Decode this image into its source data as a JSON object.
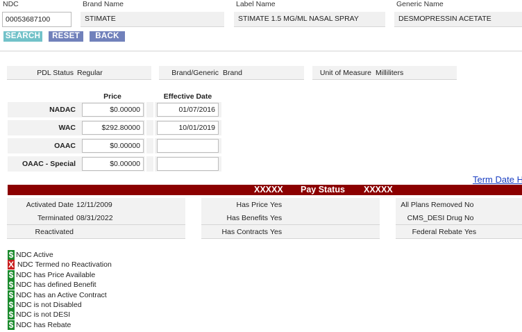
{
  "header": {
    "ndc_label": "NDC",
    "ndc_value": "00053687100",
    "brand_label": "Brand Name",
    "brand_value": "STIMATE",
    "label_label": "Label Name",
    "label_value": "STIMATE 1.5 MG/ML NASAL SPRAY",
    "generic_label": "Generic Name",
    "generic_value": "DESMOPRESSIN ACETATE"
  },
  "buttons": {
    "search": "SEARCH",
    "reset": "RESET",
    "back": "BACK"
  },
  "summary": {
    "pdl_label": "PDL Status",
    "pdl_value": "Regular",
    "bg_label": "Brand/Generic",
    "bg_value": "Brand",
    "uom_label": "Unit of Measure",
    "uom_value": "Milliliters"
  },
  "pricing": {
    "price_header": "Price",
    "date_header": "Effective Date",
    "rows": [
      {
        "label": "NADAC",
        "price": "$0.00000",
        "date": "01/07/2016"
      },
      {
        "label": "WAC",
        "price": "$292.80000",
        "date": "10/01/2019"
      },
      {
        "label": "OAAC",
        "price": "$0.00000",
        "date": ""
      },
      {
        "label": "OAAC - Special",
        "price": "$0.00000",
        "date": ""
      }
    ]
  },
  "term_link": "Term Date H",
  "banner": {
    "left": "XXXXX",
    "title": "Pay Status",
    "right": "XXXXX",
    "color": "#8b0000"
  },
  "status": {
    "col1": [
      {
        "label": "Activated Date",
        "value": "12/11/2009"
      },
      {
        "label": "Terminated",
        "value": "08/31/2022"
      },
      {
        "label": "Reactivated",
        "value": ""
      }
    ],
    "col2": [
      {
        "label": "Has Price",
        "value": "Yes"
      },
      {
        "label": "Has Benefits",
        "value": "Yes"
      },
      {
        "label": "Has Contracts",
        "value": "Yes"
      }
    ],
    "col3": [
      {
        "label": "All Plans Removed",
        "value": "No"
      },
      {
        "label": "CMS_DESI Drug",
        "value": "No"
      },
      {
        "label": "Federal Rebate",
        "value": "Yes"
      }
    ]
  },
  "legend": [
    {
      "icon": "dollar-icon",
      "glyph": "$",
      "color": "#1a8a2c",
      "text": "NDC Active"
    },
    {
      "icon": "x-icon",
      "glyph": "X",
      "color": "#c81e1e",
      "text": "NDC Termed no Reactivation"
    },
    {
      "icon": "dollar-icon",
      "glyph": "$",
      "color": "#1a8a2c",
      "text": "NDC has Price Available"
    },
    {
      "icon": "dollar-icon",
      "glyph": "$",
      "color": "#1a8a2c",
      "text": "NDC has defined Benefit"
    },
    {
      "icon": "dollar-icon",
      "glyph": "$",
      "color": "#1a8a2c",
      "text": "NDC has an Active Contract"
    },
    {
      "icon": "dollar-icon",
      "glyph": "$",
      "color": "#1a8a2c",
      "text": "NDC is not Disabled"
    },
    {
      "icon": "dollar-icon",
      "glyph": "$",
      "color": "#1a8a2c",
      "text": "NDC is not DESI"
    },
    {
      "icon": "dollar-icon",
      "glyph": "$",
      "color": "#1a8a2c",
      "text": "NDC has Rebate"
    }
  ]
}
